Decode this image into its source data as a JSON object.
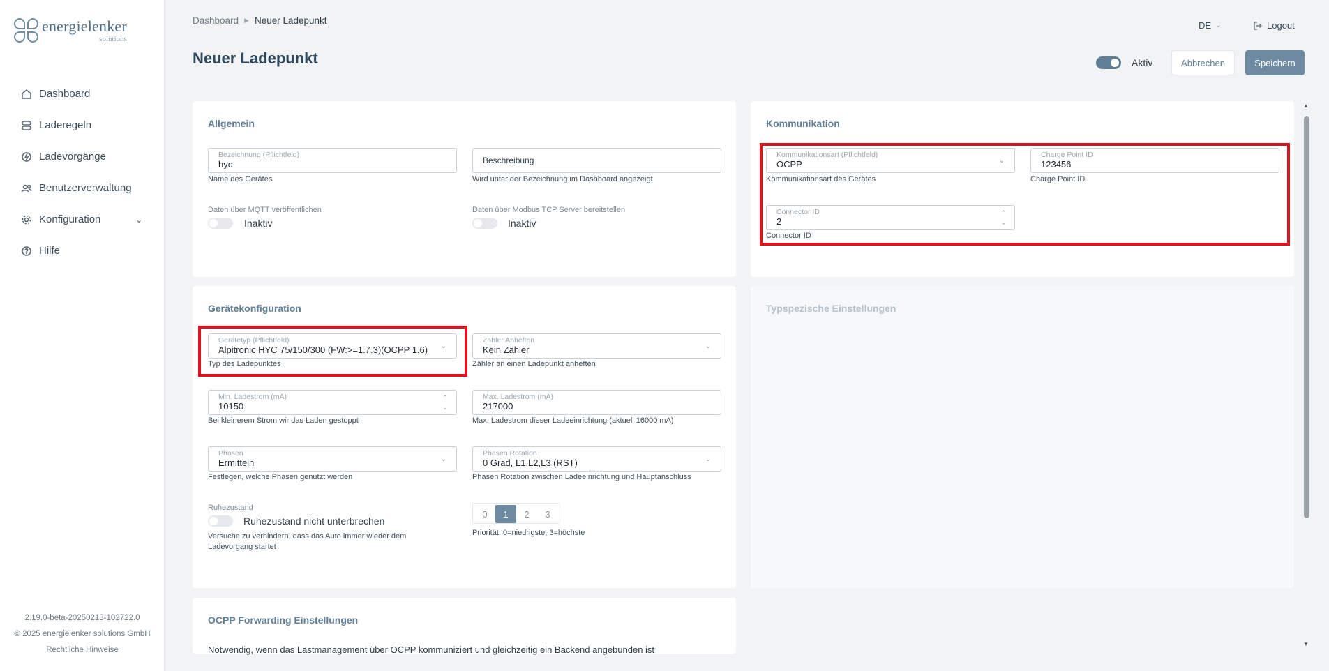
{
  "brand": {
    "name": "energielenker",
    "sub": "solutions"
  },
  "nav": {
    "items": [
      {
        "label": "Dashboard"
      },
      {
        "label": "Laderegeln"
      },
      {
        "label": "Ladevorgänge"
      },
      {
        "label": "Benutzerverwaltung"
      },
      {
        "label": "Konfiguration"
      },
      {
        "label": "Hilfe"
      }
    ]
  },
  "footer": {
    "version": "2.19.0-beta-20250213-102722.0",
    "copyright": "© 2025 energielenker solutions GmbH",
    "legal": "Rechtliche Hinweise"
  },
  "breadcrumb": {
    "root": "Dashboard",
    "current": "Neuer Ladepunkt"
  },
  "header": {
    "title": "Neuer Ladepunkt",
    "lang": "DE",
    "logout": "Logout",
    "active_label": "Aktiv",
    "active": true,
    "cancel": "Abbrechen",
    "save": "Speichern"
  },
  "allgemein": {
    "title": "Allgemein",
    "name_label": "Bezeichnung (Pflichtfeld)",
    "name_value": "hyc",
    "name_hint": "Name des Gerätes",
    "desc_placeholder": "Beschreibung",
    "desc_hint": "Wird unter der Bezeichnung im Dashboard angezeigt",
    "mqtt_label": "Daten über MQTT veröffentlichen",
    "mqtt_state": "Inaktiv",
    "modbus_label": "Daten über Modbus TCP Server bereitstellen",
    "modbus_state": "Inaktiv"
  },
  "kommunikation": {
    "title": "Kommunikation",
    "type_label": "Kommunikationsart (Pflichtfeld)",
    "type_value": "OCPP",
    "type_hint": "Kommunikationsart des Gerätes",
    "cp_label": "Charge Point ID",
    "cp_value": "123456",
    "cp_hint": "Charge Point ID",
    "conn_label": "Connector ID",
    "conn_value": "2",
    "conn_hint": "Connector ID"
  },
  "geraet": {
    "title": "Gerätekonfiguration",
    "type_label": "Gerätetyp (Pflichtfeld)",
    "type_value": "Alpitronic HYC 75/150/300 (FW:>=1.7.3)(OCPP 1.6)",
    "type_hint": "Typ des Ladepunktes",
    "meter_label": "Zähler Anheften",
    "meter_value": "Kein Zähler",
    "meter_hint": "Zähler an einen Ladepunkt anheften",
    "min_label": "Min. Ladestrom (mA)",
    "min_value": "10150",
    "min_hint": "Bei kleinerem Strom wir das Laden gestoppt",
    "max_label": "Max. Ladestrom (mA)",
    "max_value": "217000",
    "max_hint": "Max. Ladestrom dieser Ladeeinrichtung (aktuell 16000 mA)",
    "phases_label": "Phasen",
    "phases_value": "Ermitteln",
    "phases_hint": "Festlegen, welche Phasen genutzt werden",
    "rot_label": "Phasen Rotation",
    "rot_value": "0 Grad, L1,L2,L3 (RST)",
    "rot_hint": "Phasen Rotation zwischen Ladeeinrichtung und Hauptanschluss",
    "rest_label": "Ruhezustand",
    "rest_text": "Ruhezustand nicht unterbrechen",
    "rest_hint": "Versuche zu verhindern, dass das Auto immer wieder dem Ladevorgang startet",
    "priority": [
      "0",
      "1",
      "2",
      "3"
    ],
    "priority_selected": "1",
    "priority_hint": "Priorität: 0=niedrigste, 3=höchste"
  },
  "typspez": {
    "title": "Typspezische Einstellungen"
  },
  "ocpp_fwd": {
    "title": "OCPP Forwarding Einstellungen",
    "text": "Notwendig, wenn das Lastmanagement über OCPP kommuniziert und gleichzeitig ein Backend angebunden ist"
  }
}
